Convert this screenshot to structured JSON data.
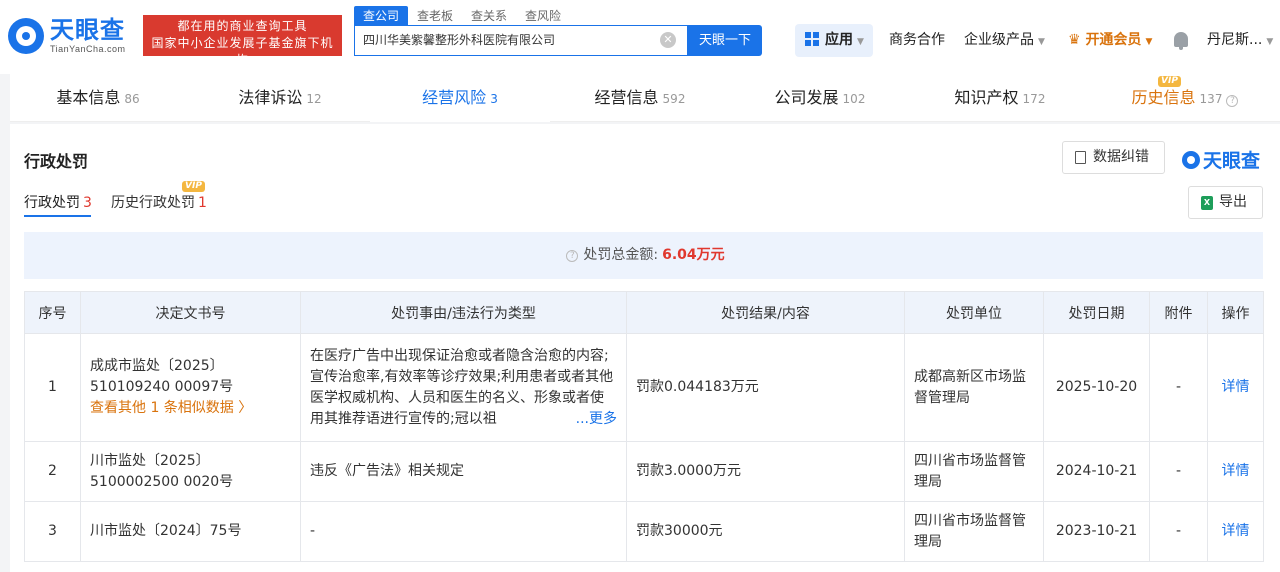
{
  "header": {
    "logo_text": "天眼查",
    "logo_sub": "TianYanCha.com",
    "slogan_line1": "都在用的商业查询工具",
    "slogan_line2": "国家中小企业发展子基金旗下机构",
    "search_tabs": [
      "查公司",
      "查老板",
      "查关系",
      "查风险"
    ],
    "search_value": "四川华美紫馨整形外科医院有限公司",
    "search_button": "天眼一下",
    "nav": {
      "app": "应用",
      "business": "商务合作",
      "enterprise": "企业级产品",
      "vip": "开通会员",
      "user": "丹尼斯..."
    }
  },
  "tabs": [
    {
      "label": "基本信息",
      "count": "86"
    },
    {
      "label": "法律诉讼",
      "count": "12"
    },
    {
      "label": "经营风险",
      "count": "3"
    },
    {
      "label": "经营信息",
      "count": "592"
    },
    {
      "label": "公司发展",
      "count": "102"
    },
    {
      "label": "知识产权",
      "count": "172"
    },
    {
      "label": "历史信息",
      "count": "137",
      "badge": "VIP"
    }
  ],
  "panel": {
    "title": "行政处罚",
    "correct_button": "数据纠错",
    "brand": "天眼查",
    "export_button": "导出",
    "subtabs": [
      {
        "label": "行政处罚",
        "count": "3"
      },
      {
        "label": "历史行政处罚",
        "count": "1",
        "badge": "VIP"
      }
    ],
    "summary_label": "处罚总金额:",
    "summary_amount": "6.04万元"
  },
  "table": {
    "headers": [
      "序号",
      "决定文书号",
      "处罚事由/违法行为类型",
      "处罚结果/内容",
      "处罚单位",
      "处罚日期",
      "附件",
      "操作"
    ],
    "rows": [
      {
        "no": "1",
        "doc": "成成市监处〔2025〕510109240 00097号",
        "similar": "查看其他 1 条相似数据 〉",
        "reason": "在医疗广告中出现保证治愈或者隐含治愈的内容;宣传治愈率,有效率等诊疗效果;利用患者或者其他医学权威机构、人员和医生的名义、形象或者使用其推荐语进行宣传的;冠以祖",
        "more": "...更多",
        "result": "罚款0.044183万元",
        "unit": "成都高新区市场监督管理局",
        "date": "2025-10-20",
        "attach": "-",
        "op": "详情"
      },
      {
        "no": "2",
        "doc": "川市监处〔2025〕5100002500 0020号",
        "reason": "违反《广告法》相关规定",
        "result": "罚款3.0000万元",
        "unit": "四川省市场监督管理局",
        "date": "2024-10-21",
        "attach": "-",
        "op": "详情"
      },
      {
        "no": "3",
        "doc": "川市监处〔2024〕75号",
        "reason": "-",
        "result": "罚款30000元",
        "unit": "四川省市场监督管理局",
        "date": "2023-10-21",
        "attach": "-",
        "op": "详情"
      }
    ]
  }
}
